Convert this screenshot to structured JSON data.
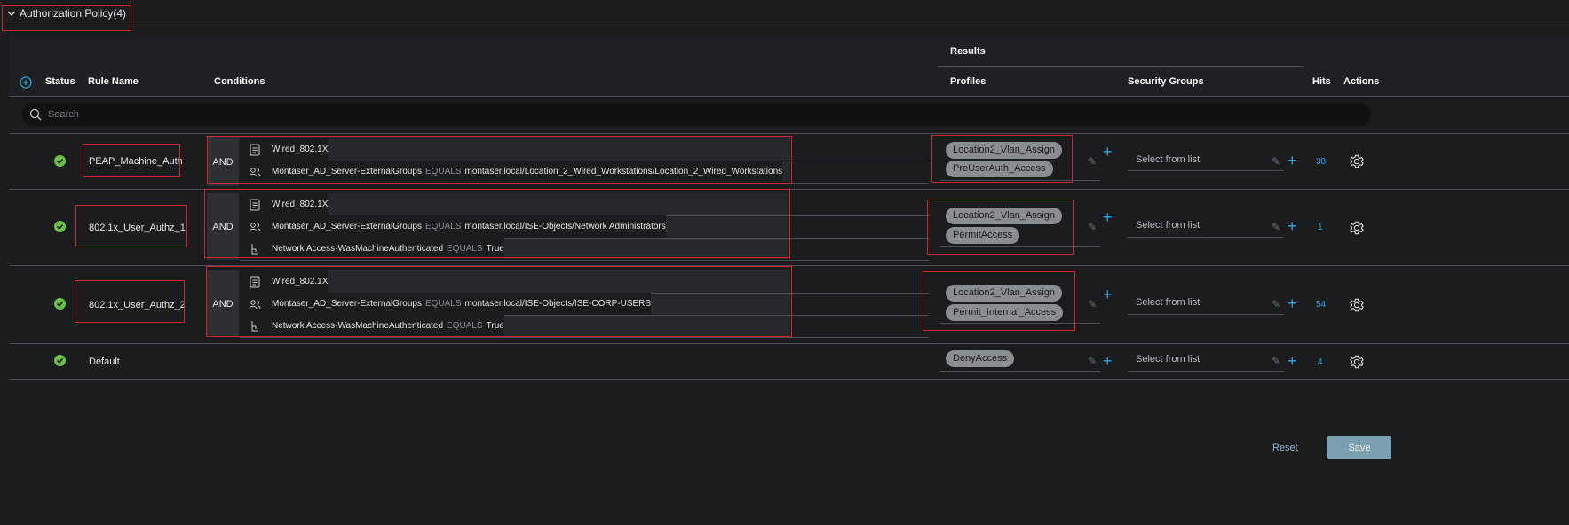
{
  "section": {
    "title": "Authorization Policy(4)"
  },
  "headers": {
    "results": "Results",
    "status": "Status",
    "rule_name": "Rule Name",
    "conditions": "Conditions",
    "profiles": "Profiles",
    "security_groups": "Security Groups",
    "hits": "Hits",
    "actions": "Actions"
  },
  "search": {
    "placeholder": "Search"
  },
  "rules": [
    {
      "name": "PEAP_Machine_Auth",
      "operator": "AND",
      "conditions": [
        {
          "icon": "document-icon",
          "attr": "Wired_802.1X",
          "op": "",
          "value": ""
        },
        {
          "icon": "user-group-icon",
          "attr": "Montaser_AD_Server-ExternalGroups",
          "op": "EQUALS",
          "value": "montaser.local/Location_2_Wired_Workstations/Location_2_Wired_Workstations"
        }
      ],
      "profiles": [
        "Location2_Vlan_Assign",
        "PreUserAuth_Access"
      ],
      "security_group": "Select from list",
      "hits": "38"
    },
    {
      "name": "802.1x_User_Authz_1",
      "operator": "AND",
      "conditions": [
        {
          "icon": "document-icon",
          "attr": "Wired_802.1X",
          "op": "",
          "value": ""
        },
        {
          "icon": "user-group-icon",
          "attr": "Montaser_AD_Server-ExternalGroups",
          "op": "EQUALS",
          "value": "montaser.local/ISE-Objects/Network Administrators"
        },
        {
          "icon": "network-access-icon",
          "attr": "Network Access·WasMachineAuthenticated",
          "op": "EQUALS",
          "value": "True"
        }
      ],
      "profiles": [
        "Location2_Vlan_Assign",
        "PermitAccess"
      ],
      "security_group": "Select from list",
      "hits": "1"
    },
    {
      "name": "802.1x_User_Authz_2",
      "operator": "AND",
      "conditions": [
        {
          "icon": "document-icon",
          "attr": "Wired_802.1X",
          "op": "",
          "value": ""
        },
        {
          "icon": "user-group-icon",
          "attr": "Montaser_AD_Server-ExternalGroups",
          "op": "EQUALS",
          "value": "montaser.local/ISE-Objects/ISE-CORP-USERS"
        },
        {
          "icon": "network-access-icon",
          "attr": "Network Access·WasMachineAuthenticated",
          "op": "EQUALS",
          "value": "True"
        }
      ],
      "profiles": [
        "Location2_Vlan_Assign",
        "Permit_Internal_Access"
      ],
      "security_group": "Select from list",
      "hits": "54"
    },
    {
      "name": "Default",
      "operator": "",
      "conditions": [],
      "profiles": [
        "DenyAccess"
      ],
      "security_group": "Select from list",
      "hits": "4"
    }
  ],
  "buttons": {
    "reset": "Reset",
    "save": "Save"
  },
  "colors": {
    "accent": "#2aa7e0",
    "status_ok": "#6cc04a",
    "highlight": "#d0262d",
    "background": "#1b1c1e"
  }
}
